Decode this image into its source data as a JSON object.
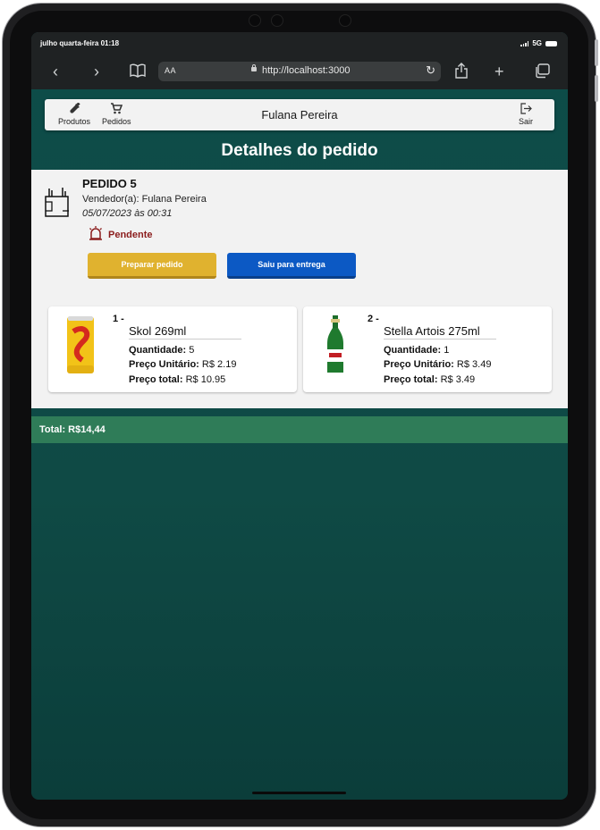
{
  "status_bar": {
    "time": "julho quarta-feira 01:18",
    "network": "5G"
  },
  "browser": {
    "text_size": "AA",
    "url": "http://localhost:3000"
  },
  "navbar": {
    "products_label": "Produtos",
    "orders_label": "Pedidos",
    "user_name": "Fulana Pereira",
    "logout_label": "Sair"
  },
  "page": {
    "title": "Detalhes do pedido"
  },
  "order": {
    "title": "PEDIDO 5",
    "seller": "Vendedor(a): Fulana Pereira",
    "date": "05/07/2023 às 00:31",
    "status": "Pendente",
    "prepare_label": "Preparar pedido",
    "ship_label": "Saiu para entrega"
  },
  "labels": {
    "quantity": "Quantidade:",
    "unit_price": "Preço Unitário:",
    "total_price": "Preço total:"
  },
  "items": [
    {
      "index": "1 -",
      "name": "Skol 269ml",
      "quantity": "5",
      "unit_price": "R$ 2.19",
      "total_price": "R$ 10.95"
    },
    {
      "index": "2 -",
      "name": "Stella Artois 275ml",
      "quantity": "1",
      "unit_price": "R$ 3.49",
      "total_price": "R$ 3.49"
    }
  ],
  "total": {
    "label": "Total: R$14,44"
  },
  "colors": {
    "background": "#0d4c49",
    "prepare_button": "#e0b22f",
    "ship_button": "#0c59c4",
    "status": "#8b1c1c",
    "total_bar": "#2f7c58"
  }
}
